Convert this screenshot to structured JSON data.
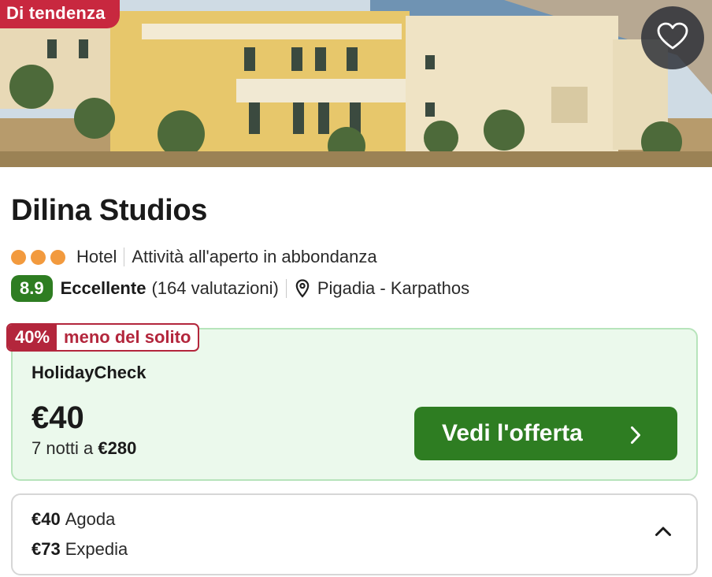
{
  "hero": {
    "badge": "Di tendenza",
    "favorite_icon": "heart-outline-icon"
  },
  "hotel": {
    "name": "Dilina Studios",
    "stars": 3,
    "type": "Hotel",
    "feature": "Attività all'aperto in abbondanza",
    "score": "8.9",
    "score_label": "Eccellente",
    "reviews": "(164 valutazioni)",
    "location": "Pigadia - Karpathos"
  },
  "deal": {
    "discount_pct": "40%",
    "discount_label": "meno del solito",
    "provider": "HolidayCheck",
    "price": "€40",
    "nights_prefix": "7 notti a",
    "nights_total": "€280",
    "cta_label": "Vedi l'offerta"
  },
  "other_offers": [
    {
      "price": "€40",
      "provider": "Agoda"
    },
    {
      "price": "€73",
      "provider": "Expedia"
    }
  ],
  "colors": {
    "badge_red": "#c8283f",
    "discount_red": "#b3263c",
    "brand_green": "#2e7d22",
    "deal_bg": "#ebf9ec",
    "star_orange": "#f29a3e"
  }
}
